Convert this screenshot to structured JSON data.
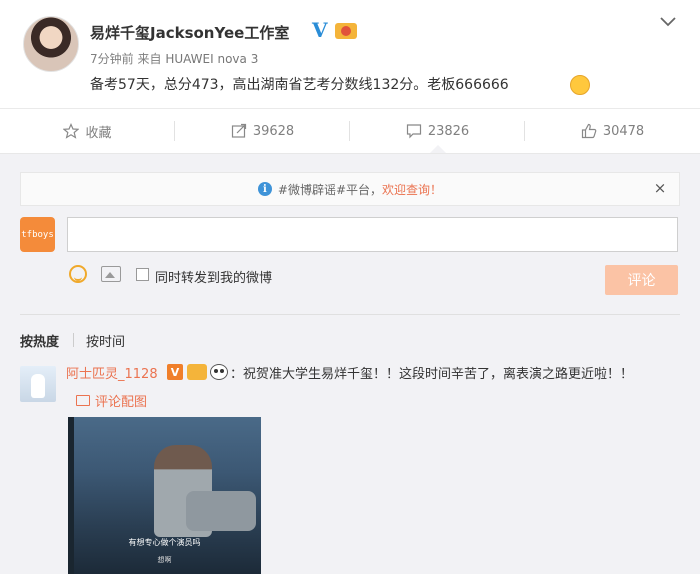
{
  "post": {
    "author": "易烊千玺JacksonYee工作室",
    "time": "7分钟前",
    "source_prefix": "来自",
    "device": "HUAWEI nova 3",
    "content": "备考57天，总分473，高出湖南省艺考分数线132分。老板666666",
    "verified_mark": "V"
  },
  "actions": {
    "favorite": "收藏",
    "repost_count": "39628",
    "comment_count": "23826",
    "like_count": "30478"
  },
  "notice": {
    "prefix": "#微博辟谣#平台，",
    "link": "欢迎查询！",
    "close": "×"
  },
  "composer": {
    "user_avatar_text": "tfboys",
    "input_value": "",
    "repost_label": "同时转发到我的微博",
    "submit_label": "评论"
  },
  "sort": {
    "hot": "按热度",
    "time": "按时间"
  },
  "comment": {
    "name": "阿士匹灵_1128",
    "vip": "V",
    "text": "：祝贺准大学生易烊千玺！！这段时间辛苦了，离表演之路更近啦！！",
    "pic_link": "评论配图",
    "image_subtitle": "有想专心做个演员吗",
    "image_subtitle2": "想啊"
  },
  "colors": {
    "accent": "#eb7350",
    "verified": "#2a8dd7",
    "submit_disabled": "#fbc3a5",
    "panel_bg": "#f2f2f5"
  }
}
